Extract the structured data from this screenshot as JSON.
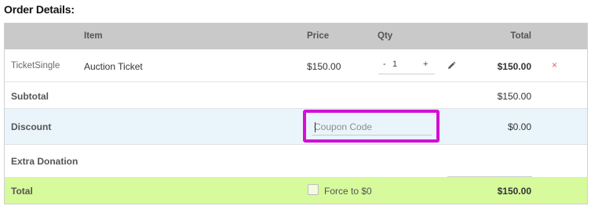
{
  "heading": "Order Details:",
  "columns": {
    "item": "Item",
    "price": "Price",
    "qty": "Qty",
    "total": "Total"
  },
  "line_item": {
    "type": "TicketSingle",
    "name": "Auction Ticket",
    "price": "$150.00",
    "qty_minus": "-",
    "qty": "1",
    "qty_plus": "+",
    "total": "$150.00",
    "remove": "×"
  },
  "subtotal": {
    "label": "Subtotal",
    "value": "$150.00"
  },
  "discount": {
    "label": "Discount",
    "coupon_placeholder": "Coupon Code",
    "value": "$0.00"
  },
  "extra_donation": {
    "label": "Extra Donation",
    "value": ""
  },
  "total": {
    "label": "Total",
    "force_label": "Force to $0",
    "value": "$150.00"
  },
  "colors": {
    "header_bg": "#c9c9c9",
    "discount_bg": "#eaf5fb",
    "total_bg": "#d6fa9c",
    "highlight_border": "#d10fd6",
    "remove_color": "#e06060"
  }
}
